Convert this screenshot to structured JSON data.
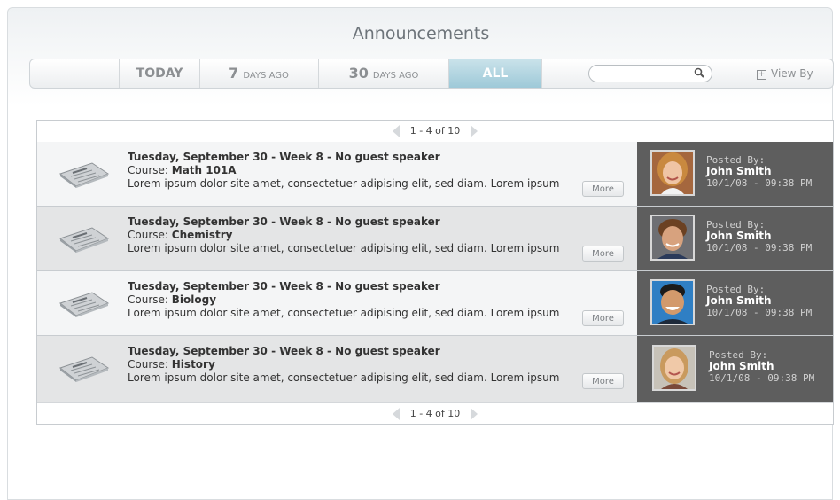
{
  "header": {
    "title": "Announcements"
  },
  "tabs": [
    {
      "label": "TODAY"
    },
    {
      "num": "7",
      "small": "DAYS AGO"
    },
    {
      "num": "30",
      "small": "DAYS AGO"
    },
    {
      "label": "ALL",
      "active": true
    }
  ],
  "search": {
    "value": "",
    "placeholder": ""
  },
  "view_by": {
    "label": "View By"
  },
  "pagination": {
    "label": "1 - 4 of 10"
  },
  "announcements": [
    {
      "headline": "Tuesday, September 30 - Week 8 - No guest speaker",
      "course_prefix": "Course: ",
      "course": "Math 101A",
      "body": "Lorem ipsum dolor site amet, consectetuer adipising elit, sed diam. Lorem ipsum",
      "more": "More",
      "posted_by_label": "Posted By:",
      "author": "John Smith",
      "timestamp": "10/1/08 - 09:38 PM",
      "avatar": "avatar-woman-blonde"
    },
    {
      "headline": "Tuesday, September 30 - Week 8 - No guest speaker",
      "course_prefix": "Course: ",
      "course": "Chemistry",
      "body": "Lorem ipsum dolor site amet, consectetuer adipising elit, sed diam. Lorem ipsum",
      "more": "More",
      "posted_by_label": "Posted By:",
      "author": "John Smith",
      "timestamp": "10/1/08 - 09:38 PM",
      "avatar": "avatar-man-brown-hair"
    },
    {
      "headline": "Tuesday, September 30 - Week 8 - No guest speaker",
      "course_prefix": "Course: ",
      "course": "Biology",
      "body": "Lorem ipsum dolor site amet, consectetuer adipising elit, sed diam. Lorem ipsum",
      "more": "More",
      "posted_by_label": "Posted By:",
      "author": "John Smith",
      "timestamp": "10/1/08 - 09:38 PM",
      "avatar": "avatar-man-smiling"
    },
    {
      "headline": "Tuesday, September 30 - Week 8 - No guest speaker",
      "course_prefix": "Course: ",
      "course": "History",
      "body": "Lorem ipsum dolor site amet, consectetuer adipising elit, sed diam. Lorem ipsum",
      "more": "More",
      "posted_by_label": "Posted By:",
      "author": "John Smith",
      "timestamp": "10/1/08 - 09:38 PM",
      "avatar": "avatar-woman-smiling"
    }
  ],
  "colors": {
    "active_tab": "#9ec9d8",
    "poster_panel": "#5e5e5e",
    "row_light": "#f4f5f6",
    "row_dark": "#e4e5e6"
  }
}
